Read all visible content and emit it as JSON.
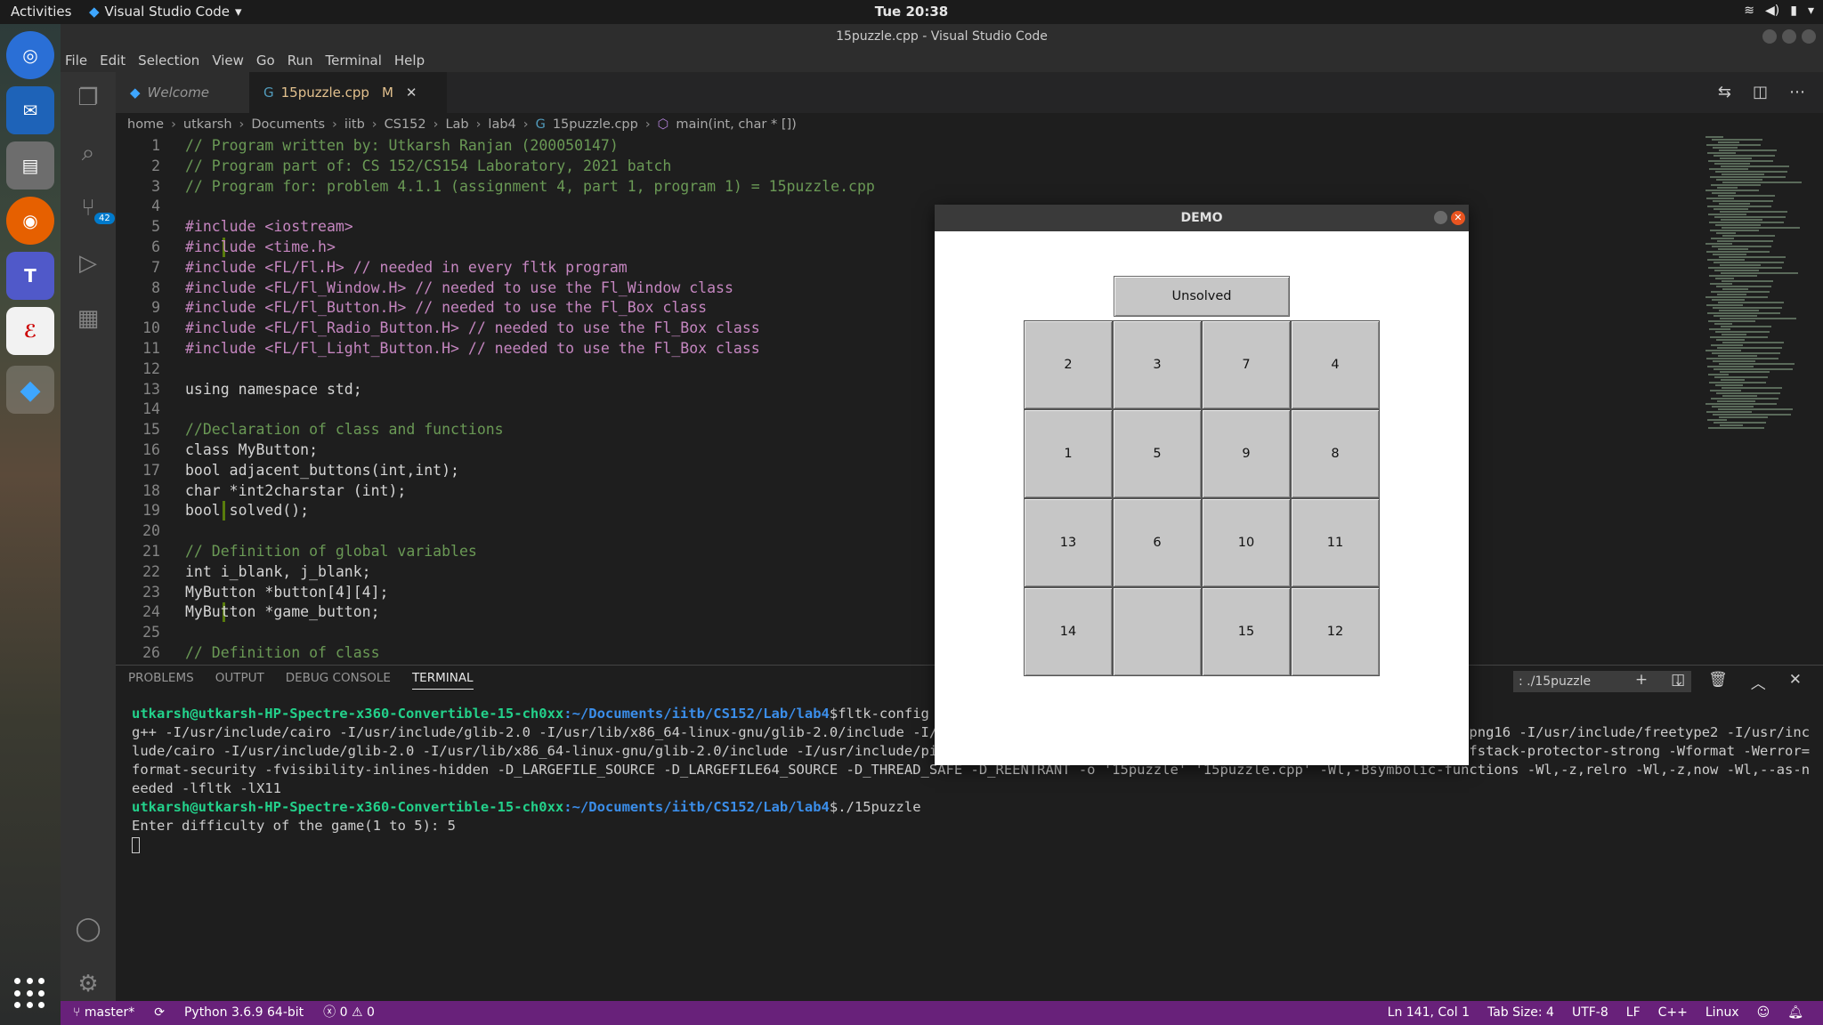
{
  "topbar": {
    "activities": "Activities",
    "app_name": "Visual Studio Code",
    "clock": "Tue 20:38"
  },
  "window_title": "15puzzle.cpp - Visual Studio Code",
  "menu": [
    "File",
    "Edit",
    "Selection",
    "View",
    "Go",
    "Run",
    "Terminal",
    "Help"
  ],
  "activity_badge": "42",
  "tabs": [
    {
      "label": "Welcome"
    },
    {
      "label": "15puzzle.cpp",
      "modified": "M"
    }
  ],
  "breadcrumb": [
    "home",
    "utkarsh",
    "Documents",
    "iitb",
    "CS152",
    "Lab",
    "lab4",
    "15puzzle.cpp",
    "main(int, char * [])"
  ],
  "code_lines": [
    {
      "n": "1",
      "cls": "c-comment",
      "text": "// Program written by: Utkarsh Ranjan (200050147)"
    },
    {
      "n": "2",
      "cls": "c-comment",
      "text": "// Program part of: CS 152/CS154 Laboratory, 2021 batch"
    },
    {
      "n": "3",
      "cls": "c-comment",
      "text": "// Program for: problem 4.1.1 (assignment 4, part 1, program 1) = 15puzzle.cpp"
    },
    {
      "n": "4",
      "cls": "c-plain",
      "text": ""
    },
    {
      "n": "5",
      "cls": "c-keyword",
      "text": "#include <iostream>"
    },
    {
      "n": "6",
      "cls": "c-keyword",
      "text": "#include <time.h>",
      "mod": true
    },
    {
      "n": "7",
      "cls": "c-keyword",
      "text": "#include <FL/Fl.H> // needed in every fltk program"
    },
    {
      "n": "8",
      "cls": "c-keyword",
      "text": "#include <FL/Fl_Window.H> // needed to use the Fl_Window class"
    },
    {
      "n": "9",
      "cls": "c-keyword",
      "text": "#include <FL/Fl_Button.H> // needed to use the Fl_Box class"
    },
    {
      "n": "10",
      "cls": "c-keyword",
      "text": "#include <FL/Fl_Radio_Button.H> // needed to use the Fl_Box class"
    },
    {
      "n": "11",
      "cls": "c-keyword",
      "text": "#include <FL/Fl_Light_Button.H> // needed to use the Fl_Box class"
    },
    {
      "n": "12",
      "cls": "c-plain",
      "text": ""
    },
    {
      "n": "13",
      "cls": "c-plain",
      "text": "using namespace std;"
    },
    {
      "n": "14",
      "cls": "c-plain",
      "text": ""
    },
    {
      "n": "15",
      "cls": "c-comment",
      "text": "//Declaration of class and functions"
    },
    {
      "n": "16",
      "cls": "c-plain",
      "text": "class MyButton;"
    },
    {
      "n": "17",
      "cls": "c-plain",
      "text": "bool adjacent_buttons(int,int);"
    },
    {
      "n": "18",
      "cls": "c-plain",
      "text": "char *int2charstar (int);"
    },
    {
      "n": "19",
      "cls": "c-plain",
      "text": "bool solved();",
      "mod": true
    },
    {
      "n": "20",
      "cls": "c-plain",
      "text": ""
    },
    {
      "n": "21",
      "cls": "c-comment",
      "text": "// Definition of global variables"
    },
    {
      "n": "22",
      "cls": "c-plain",
      "text": "int i_blank, j_blank;"
    },
    {
      "n": "23",
      "cls": "c-plain",
      "text": "MyButton *button[4][4];"
    },
    {
      "n": "24",
      "cls": "c-plain",
      "text": "MyButton *game_button;",
      "mod": true
    },
    {
      "n": "25",
      "cls": "c-plain",
      "text": ""
    },
    {
      "n": "26",
      "cls": "c-comment",
      "text": "// Definition of class"
    }
  ],
  "panel": {
    "tabs": [
      "PROBLEMS",
      "OUTPUT",
      "DEBUG CONSOLE",
      "TERMINAL"
    ],
    "active_tab": "TERMINAL",
    "terminal_select": ": ./15puzzle"
  },
  "terminal": {
    "prompt_user": "utkarsh@utkarsh-HP-Spectre-x360-Convertible-15-ch0xx",
    "prompt_path": ":~/Documents/iitb/CS152/Lab/lab4",
    "cmd1": "$fltk-config --compile 15puzzle.cpp",
    "output1": "g++ -I/usr/include/cairo -I/usr/include/glib-2.0 -I/usr/lib/x86_64-linux-gnu/glib-2.0/include -I/usr/include/pixman-1 -I/usr/include/freetype2 -I/usr/include/libpng16 -I/usr/include/freetype2 -I/usr/include/cairo -I/usr/include/glib-2.0 -I/usr/lib/x86_64-linux-gnu/glib-2.0/include -I/usr/include/pixman-1 -I/usr/include/freetype2 -I/usr/include/libpng16 -g -O2 -fstack-protector-strong -Wformat -Werror=format-security -fvisibility-inlines-hidden -D_LARGEFILE_SOURCE -D_LARGEFILE64_SOURCE -D_THREAD_SAFE -D_REENTRANT -o '15puzzle' '15puzzle.cpp' -Wl,-Bsymbolic-functions -Wl,-z,relro -Wl,-z,now -Wl,--as-needed -lfltk -lX11",
    "cmd2": "$./15puzzle",
    "output2": "Enter difficulty of the game(1 to 5): 5"
  },
  "statusbar": {
    "branch": "master*",
    "python": "Python 3.6.9 64-bit",
    "problems": "0",
    "warnings": "0",
    "position": "Ln 141, Col 1",
    "tab_size": "Tab Size: 4",
    "encoding": "UTF-8",
    "eol": "LF",
    "language": "C++",
    "platform": "Linux"
  },
  "demo": {
    "title": "DEMO",
    "status": "Unsolved",
    "board": [
      [
        "2",
        "3",
        "7",
        "4"
      ],
      [
        "1",
        "5",
        "9",
        "8"
      ],
      [
        "13",
        "6",
        "10",
        "11"
      ],
      [
        "14",
        "",
        "15",
        "12"
      ]
    ]
  },
  "colors": {
    "statusbar": "#68217a",
    "editor_bg": "#1e1e1e",
    "terminal_user": "#23d18b",
    "terminal_path": "#3b8eea",
    "puzzle_tile": "#c6c6c6"
  }
}
